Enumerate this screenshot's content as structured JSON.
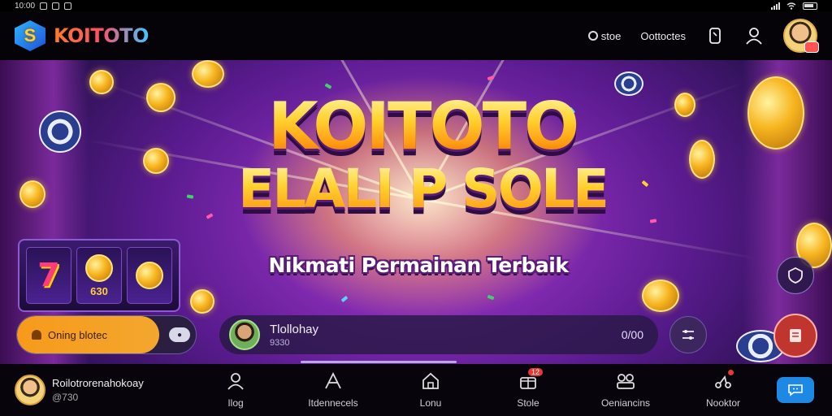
{
  "status_bar": {
    "time": "10:00"
  },
  "header": {
    "brand": "KOITOTO",
    "links": [
      {
        "label": "stoe"
      },
      {
        "label": "Oottoctes"
      }
    ]
  },
  "banner": {
    "title": "KOITOTO",
    "subtitle": "ELALI P SOLE",
    "tagline": "Nikmati Permainan Terbaik",
    "slot": {
      "symbol": "7",
      "amount": "630"
    },
    "promo": {
      "label": "Oning blotec"
    },
    "player": {
      "name": "Tlollohay",
      "sub": "9330",
      "amount": "0/00"
    }
  },
  "bottom_nav": {
    "profile": {
      "name": "Roilotrorenahokoay",
      "balance": "@730"
    },
    "items": [
      {
        "label": "Ilog",
        "icon": "user-icon"
      },
      {
        "label": "Itdennecels",
        "icon": "growth-icon"
      },
      {
        "label": "Lonu",
        "icon": "home-icon"
      },
      {
        "label": "Stole",
        "icon": "gift-icon",
        "badge": "12"
      },
      {
        "label": "Oeniancins",
        "icon": "team-icon"
      },
      {
        "label": "Nooktor",
        "icon": "share-icon"
      }
    ]
  },
  "colors": {
    "accent_orange": "#f79a1b",
    "brand_blue": "#1e88e5",
    "banner_purple": "#5a1b8f"
  }
}
